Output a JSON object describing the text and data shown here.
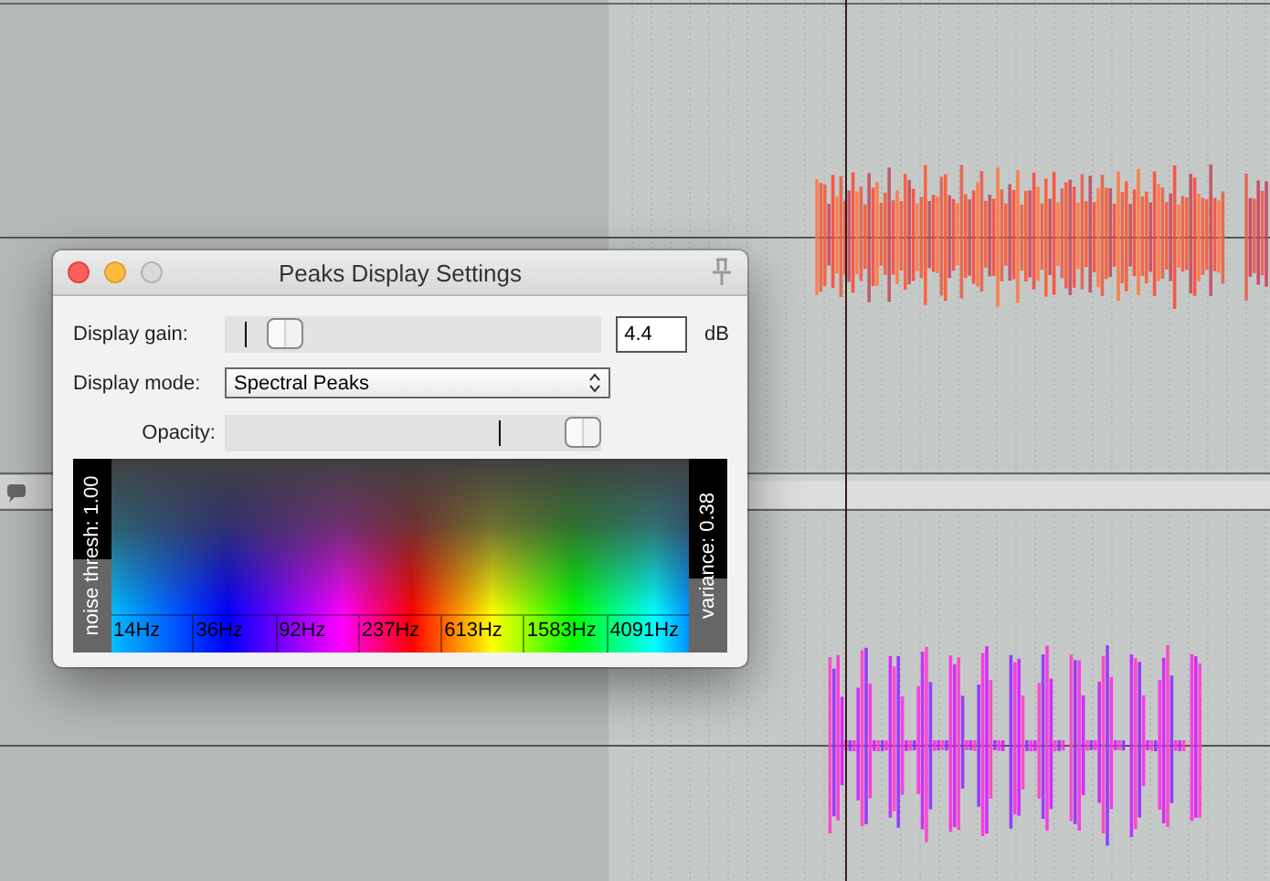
{
  "window": {
    "title": "Peaks Display Settings"
  },
  "display_gain": {
    "label": "Display gain:",
    "level": 0.16,
    "value": "4.4",
    "unit": "dB"
  },
  "display_mode": {
    "label": "Display mode:",
    "value": "Spectral Peaks"
  },
  "opacity": {
    "label": "Opacity:",
    "level": 0.95
  },
  "spectrum": {
    "left_label": "noise thresh: 1.00",
    "right_label": "variance: 0.38",
    "frequencies": [
      "14Hz",
      "36Hz",
      "92Hz",
      "237Hz",
      "613Hz",
      "1583Hz",
      "4091Hz"
    ]
  }
}
